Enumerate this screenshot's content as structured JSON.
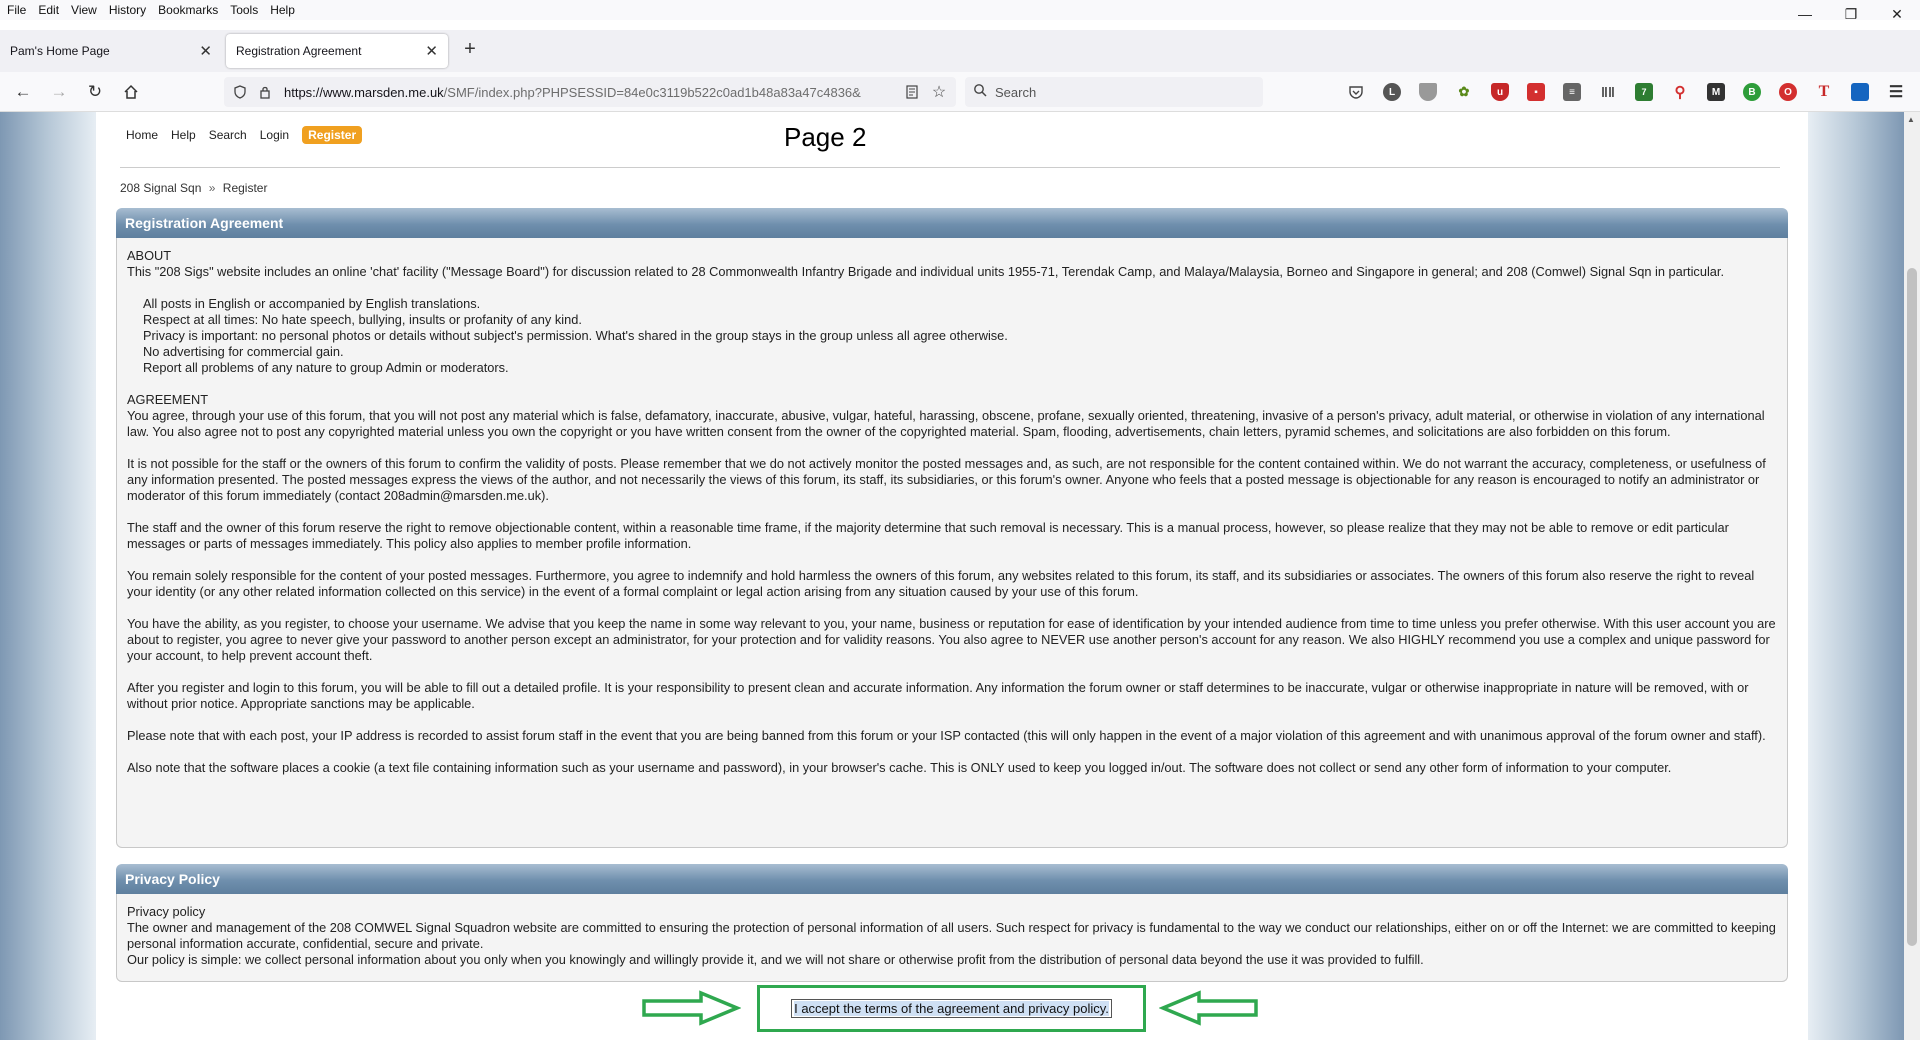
{
  "browser": {
    "menu": [
      "File",
      "Edit",
      "View",
      "History",
      "Bookmarks",
      "Tools",
      "Help"
    ],
    "tabs": [
      {
        "title": "Pam's Home Page",
        "active": false
      },
      {
        "title": "Registration Agreement",
        "active": true
      }
    ],
    "url_host": "https://www.marsden.me.uk",
    "url_path": "/SMF/index.php?PHPSESSID=84e0c3119b522c0ad1b48a83a47c4836&",
    "search_placeholder": "Search",
    "extension_badge": "7"
  },
  "page": {
    "title": "Page 2",
    "nav": {
      "home": "Home",
      "help": "Help",
      "search": "Search",
      "login": "Login",
      "register": "Register"
    },
    "breadcrumb": {
      "root": "208 Signal Sqn",
      "sep": "»",
      "current": "Register"
    },
    "agreement": {
      "heading": "Registration Agreement",
      "about_title": "ABOUT",
      "about_text": "This \"208 Sigs\" website includes an online 'chat' facility (\"Message Board\") for discussion related to 28 Commonwealth Infantry Brigade and individual units 1955-71, Terendak Camp, and Malaya/Malaysia, Borneo and Singapore in general; and 208 (Comwel) Signal Sqn in particular.",
      "rules": [
        "All posts in English or accompanied by English translations.",
        "Respect at all times: No hate speech, bullying, insults or profanity of any kind.",
        "Privacy is important: no personal photos or details without subject's permission. What's shared in the group stays in the group unless all agree otherwise.",
        "No advertising for commercial gain.",
        "Report all problems of any nature to group Admin or moderators."
      ],
      "agreement_title": "AGREEMENT",
      "paragraphs": [
        "You agree, through your use of this forum, that you will not post any material which is false, defamatory, inaccurate, abusive, vulgar, hateful, harassing, obscene, profane, sexually oriented, threatening, invasive of a person's privacy, adult material, or otherwise in violation of any international law. You also agree not to post any copyrighted material unless you own the copyright or you have written consent from the owner of the copyrighted material. Spam, flooding, advertisements, chain letters, pyramid schemes, and solicitations are also forbidden on this forum.",
        "It is not possible for the staff or the owners of this forum to confirm the validity of posts. Please remember that we do not actively monitor the posted messages and, as such, are not responsible for the content contained within. We do not warrant the accuracy, completeness, or usefulness of any information presented. The posted messages express the views of the author, and not necessarily the views of this forum, its staff, its subsidiaries, or this forum's owner. Anyone who feels that a posted message is objectionable for any reason is encouraged to notify an administrator or moderator of this forum immediately (contact 208admin@marsden.me.uk).",
        "The staff and the owner of this forum reserve the right to remove objectionable content, within a reasonable time frame, if the majority determine that such removal is necessary. This is a manual process, however, so please realize that they may not be able to remove or edit particular messages or parts of messages immediately. This policy also applies to member profile information.",
        "You remain solely responsible for the content of your posted messages. Furthermore, you agree to indemnify and hold harmless the owners of this forum, any websites related to this forum, its staff, and its subsidiaries or associates. The owners of this forum also reserve the right to reveal your identity (or any other related information collected on this service) in the event of a formal complaint or legal action arising from any situation caused by your use of this forum.",
        "You have the ability, as you register, to choose your username. We advise that you keep the name in some way relevant to you, your name, business or reputation for ease of identification by your intended audience from time to time unless you prefer otherwise. With this user account you are about to register, you agree to never give your password to another person except an administrator, for your protection and for validity reasons. You also agree to NEVER use another person's account for any reason.  We also HIGHLY recommend you use a complex and unique password for your account, to help prevent account theft.",
        "After you register and login to this forum, you will be able to fill out a detailed profile. It is your responsibility to present clean and accurate information. Any information the forum owner or staff determines to be inaccurate, vulgar or otherwise inappropriate in nature will be removed, with or without prior notice. Appropriate sanctions may be applicable.",
        "Please note that with each post, your IP address is recorded to assist forum staff in the event that you are being banned from this forum or your ISP contacted (this will only happen in the event of a major violation of this agreement and with unanimous approval of the forum owner and staff).",
        "Also note that the software places a cookie (a text file containing information such as your username and password), in your browser's cache. This is ONLY used to keep you logged in/out. The software does not collect or send any other form of information to your computer."
      ]
    },
    "privacy": {
      "heading": "Privacy Policy",
      "subtitle": "Privacy policy",
      "text1": "The owner and management of the 208 COMWEL Signal Squadron website are committed to ensuring the protection of personal information of all users. Such respect for privacy is fundamental to the way we conduct our relationships, either on or off the Internet: we are committed to keeping personal information accurate, confidential, secure and private.",
      "text2": "Our policy is simple: we collect personal information about you only when you knowingly and willingly provide it, and we will not share or otherwise profit from the distribution of personal data beyond the use it was provided to fulfill."
    },
    "accept_label": "I accept the terms of the agreement and privacy policy."
  },
  "colors": {
    "accent_orange": "#f0a020",
    "header_blue": "#6f8fad",
    "highlight_green": "#2fa84f"
  }
}
